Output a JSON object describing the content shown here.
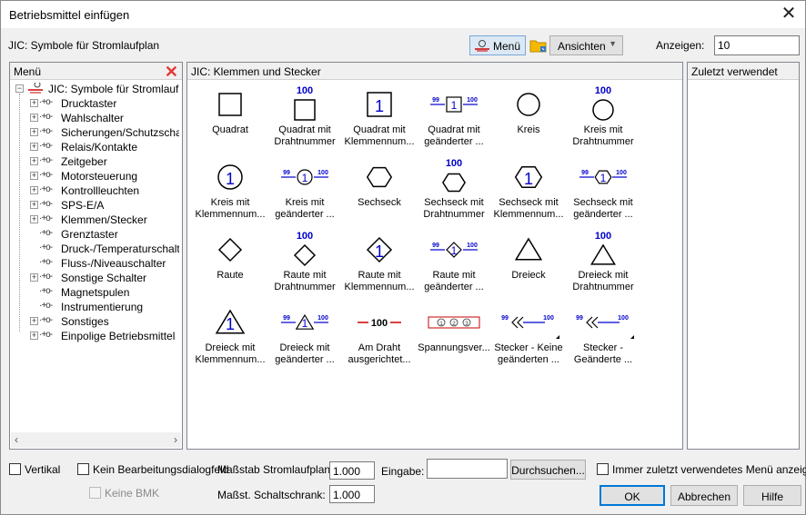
{
  "window": {
    "title": "Betriebsmittel einfügen"
  },
  "toolbar": {
    "catalog_label": "JIC: Symbole für Stromlaufplan",
    "menu_button": "Menü",
    "views_button": "Ansichten",
    "display_label": "Anzeigen:",
    "display_value": "10"
  },
  "menu_panel": {
    "header": "Menü",
    "root": "JIC: Symbole für Stromlaufplan",
    "items": [
      {
        "label": "Drucktaster",
        "expandable": true
      },
      {
        "label": "Wahlschalter",
        "expandable": true
      },
      {
        "label": "Sicherungen/Schutzschalt",
        "expandable": true
      },
      {
        "label": "Relais/Kontakte",
        "expandable": true
      },
      {
        "label": "Zeitgeber",
        "expandable": true
      },
      {
        "label": "Motorsteuerung",
        "expandable": true
      },
      {
        "label": "Kontrollleuchten",
        "expandable": true
      },
      {
        "label": "SPS-E/A",
        "expandable": true
      },
      {
        "label": "Klemmen/Stecker",
        "expandable": true
      },
      {
        "label": "Grenztaster",
        "expandable": false
      },
      {
        "label": "Druck-/Temperaturschalter",
        "expandable": false
      },
      {
        "label": "Fluss-/Niveauschalter",
        "expandable": false
      },
      {
        "label": "Sonstige Schalter",
        "expandable": true
      },
      {
        "label": "Magnetspulen",
        "expandable": false
      },
      {
        "label": "Instrumentierung",
        "expandable": false
      },
      {
        "label": "Sonstiges",
        "expandable": true
      },
      {
        "label": "Einpolige Betriebsmittel",
        "expandable": true
      }
    ]
  },
  "symbols_panel": {
    "header": "JIC: Klemmen und Stecker",
    "symbols": [
      {
        "caption1": "Quadrat",
        "caption2": "",
        "shape": "square",
        "variant": "plain"
      },
      {
        "caption1": "Quadrat mit",
        "caption2": "Drahtnummer",
        "shape": "square",
        "variant": "wire"
      },
      {
        "caption1": "Quadrat mit",
        "caption2": "Klemmennum...",
        "shape": "square",
        "variant": "term"
      },
      {
        "caption1": "Quadrat mit",
        "caption2": "geänderter ...",
        "shape": "square",
        "variant": "changed"
      },
      {
        "caption1": "Kreis",
        "caption2": "",
        "shape": "circle",
        "variant": "plain"
      },
      {
        "caption1": "Kreis mit",
        "caption2": "Drahtnummer",
        "shape": "circle",
        "variant": "wire"
      },
      {
        "caption1": "Kreis mit",
        "caption2": "Klemmennum...",
        "shape": "circle",
        "variant": "term"
      },
      {
        "caption1": "Kreis mit",
        "caption2": "geänderter ...",
        "shape": "circle",
        "variant": "changed"
      },
      {
        "caption1": "Sechseck",
        "caption2": "",
        "shape": "hex",
        "variant": "plain"
      },
      {
        "caption1": "Sechseck mit",
        "caption2": "Drahtnummer",
        "shape": "hex",
        "variant": "wire"
      },
      {
        "caption1": "Sechseck mit",
        "caption2": "Klemmennum...",
        "shape": "hex",
        "variant": "term"
      },
      {
        "caption1": "Sechseck mit",
        "caption2": "geänderter ...",
        "shape": "hex",
        "variant": "changed"
      },
      {
        "caption1": "Raute",
        "caption2": "",
        "shape": "diamond",
        "variant": "plain"
      },
      {
        "caption1": "Raute mit",
        "caption2": "Drahtnummer",
        "shape": "diamond",
        "variant": "wire"
      },
      {
        "caption1": "Raute mit",
        "caption2": "Klemmennum...",
        "shape": "diamond",
        "variant": "term"
      },
      {
        "caption1": "Raute mit",
        "caption2": "geänderter ...",
        "shape": "diamond",
        "variant": "changed"
      },
      {
        "caption1": "Dreieck",
        "caption2": "",
        "shape": "triangle",
        "variant": "plain"
      },
      {
        "caption1": "Dreieck mit",
        "caption2": "Drahtnummer",
        "shape": "triangle",
        "variant": "wire"
      },
      {
        "caption1": "Dreieck mit",
        "caption2": "Klemmennum...",
        "shape": "triangle",
        "variant": "term"
      },
      {
        "caption1": "Dreieck mit",
        "caption2": "geänderter ...",
        "shape": "triangle",
        "variant": "changed"
      },
      {
        "caption1": "Am Draht",
        "caption2": "ausgerichtet...",
        "shape": "wire",
        "variant": "plain"
      },
      {
        "caption1": "Spannungsver...",
        "caption2": "",
        "shape": "strip",
        "variant": "plain"
      },
      {
        "caption1": "Stecker - Keine",
        "caption2": "geänderten ...",
        "shape": "plug",
        "variant": "plain"
      },
      {
        "caption1": "Stecker -",
        "caption2": "Geänderte ...",
        "shape": "plug",
        "variant": "changed"
      }
    ],
    "wire_number": "100",
    "terminal_number": "1",
    "small_number": "99",
    "strip_numbers": [
      "1",
      "2",
      "3"
    ]
  },
  "recent_panel": {
    "header": "Zuletzt verwendet"
  },
  "bottom": {
    "vertical_label": "Vertikal",
    "no_edit_label": "Kein Bearbeitungsdialogfeld",
    "no_bmk_label": "Keine BMK",
    "scale_schematic_label": "Maßstab Stromlaufplan:",
    "scale_schematic_value": "1.000",
    "scale_cabinet_label": "Maßst. Schaltschrank:",
    "scale_cabinet_value": "1.000",
    "input_label": "Eingabe:",
    "input_value": "",
    "browse_button": "Durchsuchen...",
    "always_recent_label": "Immer zuletzt verwendetes Menü anzeigen",
    "ok_button": "OK",
    "cancel_button": "Abbrechen",
    "help_button": "Hilfe"
  },
  "colors": {
    "symbol_blue": "#0000cc",
    "wire_red": "#cc0000",
    "close_red": "#e53935",
    "accent": "#0078d7"
  }
}
